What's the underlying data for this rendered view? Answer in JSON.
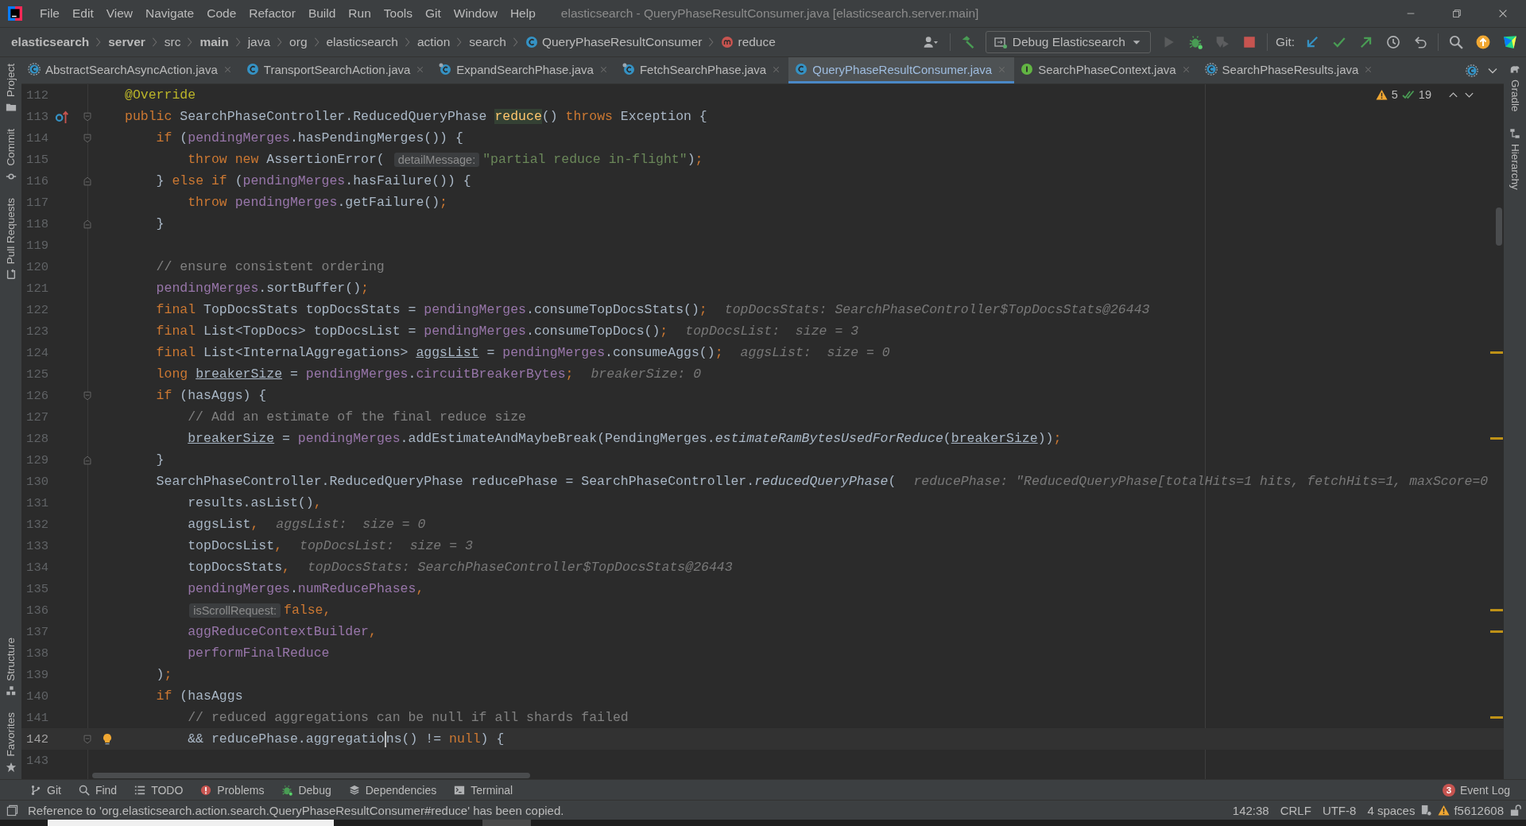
{
  "title_bar": {
    "menus": [
      "File",
      "Edit",
      "View",
      "Navigate",
      "Code",
      "Refactor",
      "Build",
      "Run",
      "Tools",
      "Git",
      "Window",
      "Help"
    ],
    "title": "elasticsearch - QueryPhaseResultConsumer.java [elasticsearch.server.main]"
  },
  "breadcrumbs": [
    {
      "label": "elasticsearch",
      "bold": true
    },
    {
      "label": "server",
      "bold": true
    },
    {
      "label": "src",
      "bold": false
    },
    {
      "label": "main",
      "bold": true
    },
    {
      "label": "java",
      "bold": false
    },
    {
      "label": "org",
      "bold": false
    },
    {
      "label": "elasticsearch",
      "bold": false
    },
    {
      "label": "action",
      "bold": false
    },
    {
      "label": "search",
      "bold": false
    },
    {
      "label": "QueryPhaseResultConsumer",
      "bold": false,
      "kind": "class"
    },
    {
      "label": "reduce",
      "bold": false,
      "kind": "method"
    }
  ],
  "toolbar": [
    {
      "kind": "user"
    },
    {
      "kind": "separator"
    },
    {
      "kind": "build"
    },
    {
      "kind": "run_config",
      "label": "Debug Elasticsearch"
    },
    {
      "kind": "run",
      "disabled": true
    },
    {
      "kind": "debug",
      "disabled": false
    },
    {
      "kind": "coverage",
      "disabled": true
    },
    {
      "kind": "stop",
      "disabled": false
    },
    {
      "kind": "separator"
    },
    {
      "kind": "label",
      "label": "Git:"
    },
    {
      "kind": "update"
    },
    {
      "kind": "commit"
    },
    {
      "kind": "push"
    },
    {
      "kind": "history"
    },
    {
      "kind": "rollback"
    },
    {
      "kind": "separator"
    },
    {
      "kind": "search"
    },
    {
      "kind": "updates"
    },
    {
      "kind": "toolbox"
    }
  ],
  "tool_strips": {
    "left_top": [
      {
        "label": "Project",
        "kind": "folder"
      },
      {
        "label": "Commit",
        "kind": "commit"
      },
      {
        "label": "Pull Requests",
        "kind": "pull"
      }
    ],
    "left_bottom": [
      {
        "label": "Structure",
        "kind": "structure"
      },
      {
        "label": "Favorites",
        "kind": "star"
      }
    ],
    "right": [
      {
        "label": "Gradle",
        "kind": "gradle"
      },
      {
        "label": "Hierarchy",
        "kind": "hierarchy"
      }
    ]
  },
  "tabs": [
    {
      "label": "AbstractSearchAsyncAction.java",
      "kind": "abstract",
      "selected": false
    },
    {
      "label": "TransportSearchAction.java",
      "kind": "class",
      "selected": false
    },
    {
      "label": "ExpandSearchPhase.java",
      "kind": "final",
      "selected": false
    },
    {
      "label": "FetchSearchPhase.java",
      "kind": "final",
      "selected": false
    },
    {
      "label": "QueryPhaseResultConsumer.java",
      "kind": "class",
      "selected": true
    },
    {
      "label": "SearchPhaseContext.java",
      "kind": "interface",
      "selected": false
    },
    {
      "label": "SearchPhaseResults.java",
      "kind": "abstract",
      "selected": false
    }
  ],
  "tabs_overflow": {
    "kind": "abstract"
  },
  "inspections": {
    "warnings": "5",
    "weak_warnings": "19"
  },
  "lines": [
    {
      "number": "112",
      "current": false,
      "code": [
        {
          "text": "@Override",
          "kind": "ann"
        }
      ]
    },
    {
      "number": "113",
      "current": false,
      "gutter": {
        "kind": "override"
      },
      "fold": {
        "kind": "start"
      },
      "code": [
        {
          "text": "public ",
          "kind": "kw"
        },
        {
          "text": "SearchPhaseController.ReducedQueryPhase ",
          "kind": "plain"
        },
        {
          "text": "reduce",
          "kind": "hl"
        },
        {
          "text": "() ",
          "kind": "plain"
        },
        {
          "text": "throws ",
          "kind": "kw"
        },
        {
          "text": "Exception {",
          "kind": "plain"
        }
      ]
    },
    {
      "number": "114",
      "current": false,
      "fold": {
        "kind": "start"
      },
      "code": [
        {
          "text": "    if ",
          "kind": "kw"
        },
        {
          "text": "(",
          "kind": "plain"
        },
        {
          "text": "pendingMerges",
          "kind": "field"
        },
        {
          "text": ".hasPendingMerges()) {",
          "kind": "plain"
        }
      ]
    },
    {
      "number": "115",
      "current": false,
      "code": [
        {
          "text": "        throw new ",
          "kind": "kw"
        },
        {
          "text": "AssertionError( ",
          "kind": "plain"
        },
        {
          "text": "detailMessage:",
          "kind": "param"
        },
        {
          "text": "\"partial reduce in-flight\"",
          "kind": "str"
        },
        {
          "text": ")",
          "kind": "plain"
        },
        {
          "text": ";",
          "kind": "kw"
        }
      ]
    },
    {
      "number": "116",
      "current": false,
      "fold": {
        "kind": "end"
      },
      "code": [
        {
          "text": "    } ",
          "kind": "plain"
        },
        {
          "text": "else if ",
          "kind": "kw"
        },
        {
          "text": "(",
          "kind": "plain"
        },
        {
          "text": "pendingMerges",
          "kind": "field"
        },
        {
          "text": ".hasFailure()) {",
          "kind": "plain"
        }
      ]
    },
    {
      "number": "117",
      "current": false,
      "code": [
        {
          "text": "        throw ",
          "kind": "kw"
        },
        {
          "text": "pendingMerges",
          "kind": "field"
        },
        {
          "text": ".getFailure()",
          "kind": "plain"
        },
        {
          "text": ";",
          "kind": "kw"
        }
      ]
    },
    {
      "number": "118",
      "current": false,
      "fold": {
        "kind": "end"
      },
      "code": [
        {
          "text": "    }",
          "kind": "plain"
        }
      ]
    },
    {
      "number": "119",
      "current": false
    },
    {
      "number": "120",
      "current": false,
      "code": [
        {
          "text": "    // ensure consistent ordering",
          "kind": "cm"
        }
      ]
    },
    {
      "number": "121",
      "current": false,
      "code": [
        {
          "text": "    pendingMerges",
          "kind": "field"
        },
        {
          "text": ".sortBuffer()",
          "kind": "plain"
        },
        {
          "text": ";",
          "kind": "kw"
        }
      ]
    },
    {
      "number": "122",
      "current": false,
      "code": [
        {
          "text": "    final ",
          "kind": "kw"
        },
        {
          "text": "TopDocsStats topDocsStats = ",
          "kind": "plain"
        },
        {
          "text": "pendingMerges",
          "kind": "field"
        },
        {
          "text": ".consumeTopDocsStats()",
          "kind": "plain"
        },
        {
          "text": ";",
          "kind": "kw"
        },
        {
          "text": "topDocsStats: SearchPhaseController$TopDocsStats@26443",
          "kind": "hint"
        }
      ]
    },
    {
      "number": "123",
      "current": false,
      "code": [
        {
          "text": "    final ",
          "kind": "kw"
        },
        {
          "text": "List<TopDocs> topDocsList = ",
          "kind": "plain"
        },
        {
          "text": "pendingMerges",
          "kind": "field"
        },
        {
          "text": ".consumeTopDocs()",
          "kind": "plain"
        },
        {
          "text": ";",
          "kind": "kw"
        },
        {
          "text": "topDocsList:  size = 3",
          "kind": "hint"
        }
      ]
    },
    {
      "number": "124",
      "current": false,
      "stripe_mark": true,
      "code": [
        {
          "text": "    final ",
          "kind": "kw"
        },
        {
          "text": "List<InternalAggregations> ",
          "kind": "plain"
        },
        {
          "text": "aggsList",
          "kind": "var"
        },
        {
          "text": " = ",
          "kind": "plain"
        },
        {
          "text": "pendingMerges",
          "kind": "field"
        },
        {
          "text": ".consumeAggs()",
          "kind": "plain"
        },
        {
          "text": ";",
          "kind": "kw"
        },
        {
          "text": "aggsList:  size = 0",
          "kind": "hint"
        }
      ]
    },
    {
      "number": "125",
      "current": false,
      "code": [
        {
          "text": "    long ",
          "kind": "kw"
        },
        {
          "text": "breakerSize",
          "kind": "var"
        },
        {
          "text": " = ",
          "kind": "plain"
        },
        {
          "text": "pendingMerges",
          "kind": "field"
        },
        {
          "text": ".",
          "kind": "plain"
        },
        {
          "text": "circuitBreakerBytes",
          "kind": "field"
        },
        {
          "text": ";",
          "kind": "kw"
        },
        {
          "text": "breakerSize: 0",
          "kind": "hint"
        }
      ]
    },
    {
      "number": "126",
      "current": false,
      "fold": {
        "kind": "start"
      },
      "code": [
        {
          "text": "    if ",
          "kind": "kw"
        },
        {
          "text": "(hasAggs) {",
          "kind": "plain"
        }
      ]
    },
    {
      "number": "127",
      "current": false,
      "code": [
        {
          "text": "        // Add an estimate of the final reduce size",
          "kind": "cm"
        }
      ]
    },
    {
      "number": "128",
      "current": false,
      "stripe_mark": true,
      "code": [
        {
          "text": "        breakerSize",
          "kind": "var"
        },
        {
          "text": " = ",
          "kind": "plain"
        },
        {
          "text": "pendingMerges",
          "kind": "field"
        },
        {
          "text": ".addEstimateAndMaybeBreak(PendingMerges.",
          "kind": "plain"
        },
        {
          "text": "estimateRamBytesUsedForReduce",
          "kind": "static"
        },
        {
          "text": "(",
          "kind": "plain"
        },
        {
          "text": "breakerSize",
          "kind": "var"
        },
        {
          "text": "))",
          "kind": "plain"
        },
        {
          "text": ";",
          "kind": "kw"
        }
      ]
    },
    {
      "number": "129",
      "current": false,
      "fold": {
        "kind": "end"
      },
      "code": [
        {
          "text": "    }",
          "kind": "plain"
        }
      ]
    },
    {
      "number": "130",
      "current": false,
      "code": [
        {
          "text": "    SearchPhaseController.ReducedQueryPhase reducePhase = SearchPhaseController.",
          "kind": "plain"
        },
        {
          "text": "reducedQueryPhase",
          "kind": "static"
        },
        {
          "text": "(",
          "kind": "plain"
        },
        {
          "text": "reducePhase: \"ReducedQueryPhase[totalHits=1 hits, fetchHits=1, maxScore=0",
          "kind": "hint"
        }
      ]
    },
    {
      "number": "131",
      "current": false,
      "code": [
        {
          "text": "        results.asList()",
          "kind": "plain"
        },
        {
          "text": ",",
          "kind": "kw"
        }
      ]
    },
    {
      "number": "132",
      "current": false,
      "code": [
        {
          "text": "        aggsList",
          "kind": "plain"
        },
        {
          "text": ",",
          "kind": "kw"
        },
        {
          "text": "aggsList:  size = 0",
          "kind": "hint"
        }
      ]
    },
    {
      "number": "133",
      "current": false,
      "code": [
        {
          "text": "        topDocsList",
          "kind": "plain"
        },
        {
          "text": ",",
          "kind": "kw"
        },
        {
          "text": "topDocsList:  size = 3",
          "kind": "hint"
        }
      ]
    },
    {
      "number": "134",
      "current": false,
      "code": [
        {
          "text": "        topDocsStats",
          "kind": "plain"
        },
        {
          "text": ",",
          "kind": "kw"
        },
        {
          "text": "topDocsStats: SearchPhaseController$TopDocsStats@26443",
          "kind": "hint"
        }
      ]
    },
    {
      "number": "135",
      "current": false,
      "code": [
        {
          "text": "        pendingMerges",
          "kind": "field"
        },
        {
          "text": ".",
          "kind": "plain"
        },
        {
          "text": "numReducePhases",
          "kind": "field"
        },
        {
          "text": ",",
          "kind": "kw"
        }
      ]
    },
    {
      "number": "136",
      "current": false,
      "stripe_mark": true,
      "code": [
        {
          "text": "isScrollRequest:",
          "kind": "param"
        },
        {
          "text": "false,",
          "kind": "kw"
        }
      ]
    },
    {
      "number": "137",
      "current": false,
      "stripe_mark": true,
      "code": [
        {
          "text": "        aggReduceContextBuilder",
          "kind": "field"
        },
        {
          "text": ",",
          "kind": "kw"
        }
      ]
    },
    {
      "number": "138",
      "current": false,
      "code": [
        {
          "text": "        performFinalReduce",
          "kind": "field"
        }
      ]
    },
    {
      "number": "139",
      "current": false,
      "code": [
        {
          "text": "    )",
          "kind": "plain"
        },
        {
          "text": ";",
          "kind": "kw"
        }
      ]
    },
    {
      "number": "140",
      "current": false,
      "code": [
        {
          "text": "    if ",
          "kind": "kw"
        },
        {
          "text": "(hasAggs",
          "kind": "plain"
        }
      ]
    },
    {
      "number": "141",
      "current": false,
      "stripe_mark": true,
      "code": [
        {
          "text": "        // reduced aggregations can be null if all shards failed",
          "kind": "cm"
        }
      ]
    },
    {
      "number": "142",
      "current": true,
      "fold": {
        "kind": "start"
      },
      "intention_bulb": true,
      "code": [
        {
          "text": "        && reducePhase.aggregatio",
          "kind": "plain",
          "caret": true
        },
        {
          "text": "ns() != ",
          "kind": "plain"
        },
        {
          "text": "null",
          "kind": "kw"
        },
        {
          "text": ") {",
          "kind": "plain"
        }
      ]
    },
    {
      "number": "143",
      "current": false
    }
  ],
  "tool_windows": [
    {
      "label": "Git",
      "kind": "git"
    },
    {
      "label": "Find",
      "kind": "find"
    },
    {
      "label": "TODO",
      "kind": "todo"
    },
    {
      "label": "Problems",
      "kind": "problems"
    },
    {
      "label": "Debug",
      "kind": "debug"
    },
    {
      "label": "Dependencies",
      "kind": "dependencies"
    },
    {
      "label": "Terminal",
      "kind": "terminal"
    }
  ],
  "event_log": {
    "label": "Event Log",
    "badge": "3"
  },
  "status_bar": {
    "message": "Reference to 'org.elasticsearch.action.search.QueryPhaseResultConsumer#reduce' has been copied.",
    "items": [
      "142:38",
      "CRLF",
      "UTF-8",
      "4 spaces"
    ],
    "vcs": "f5612608"
  }
}
